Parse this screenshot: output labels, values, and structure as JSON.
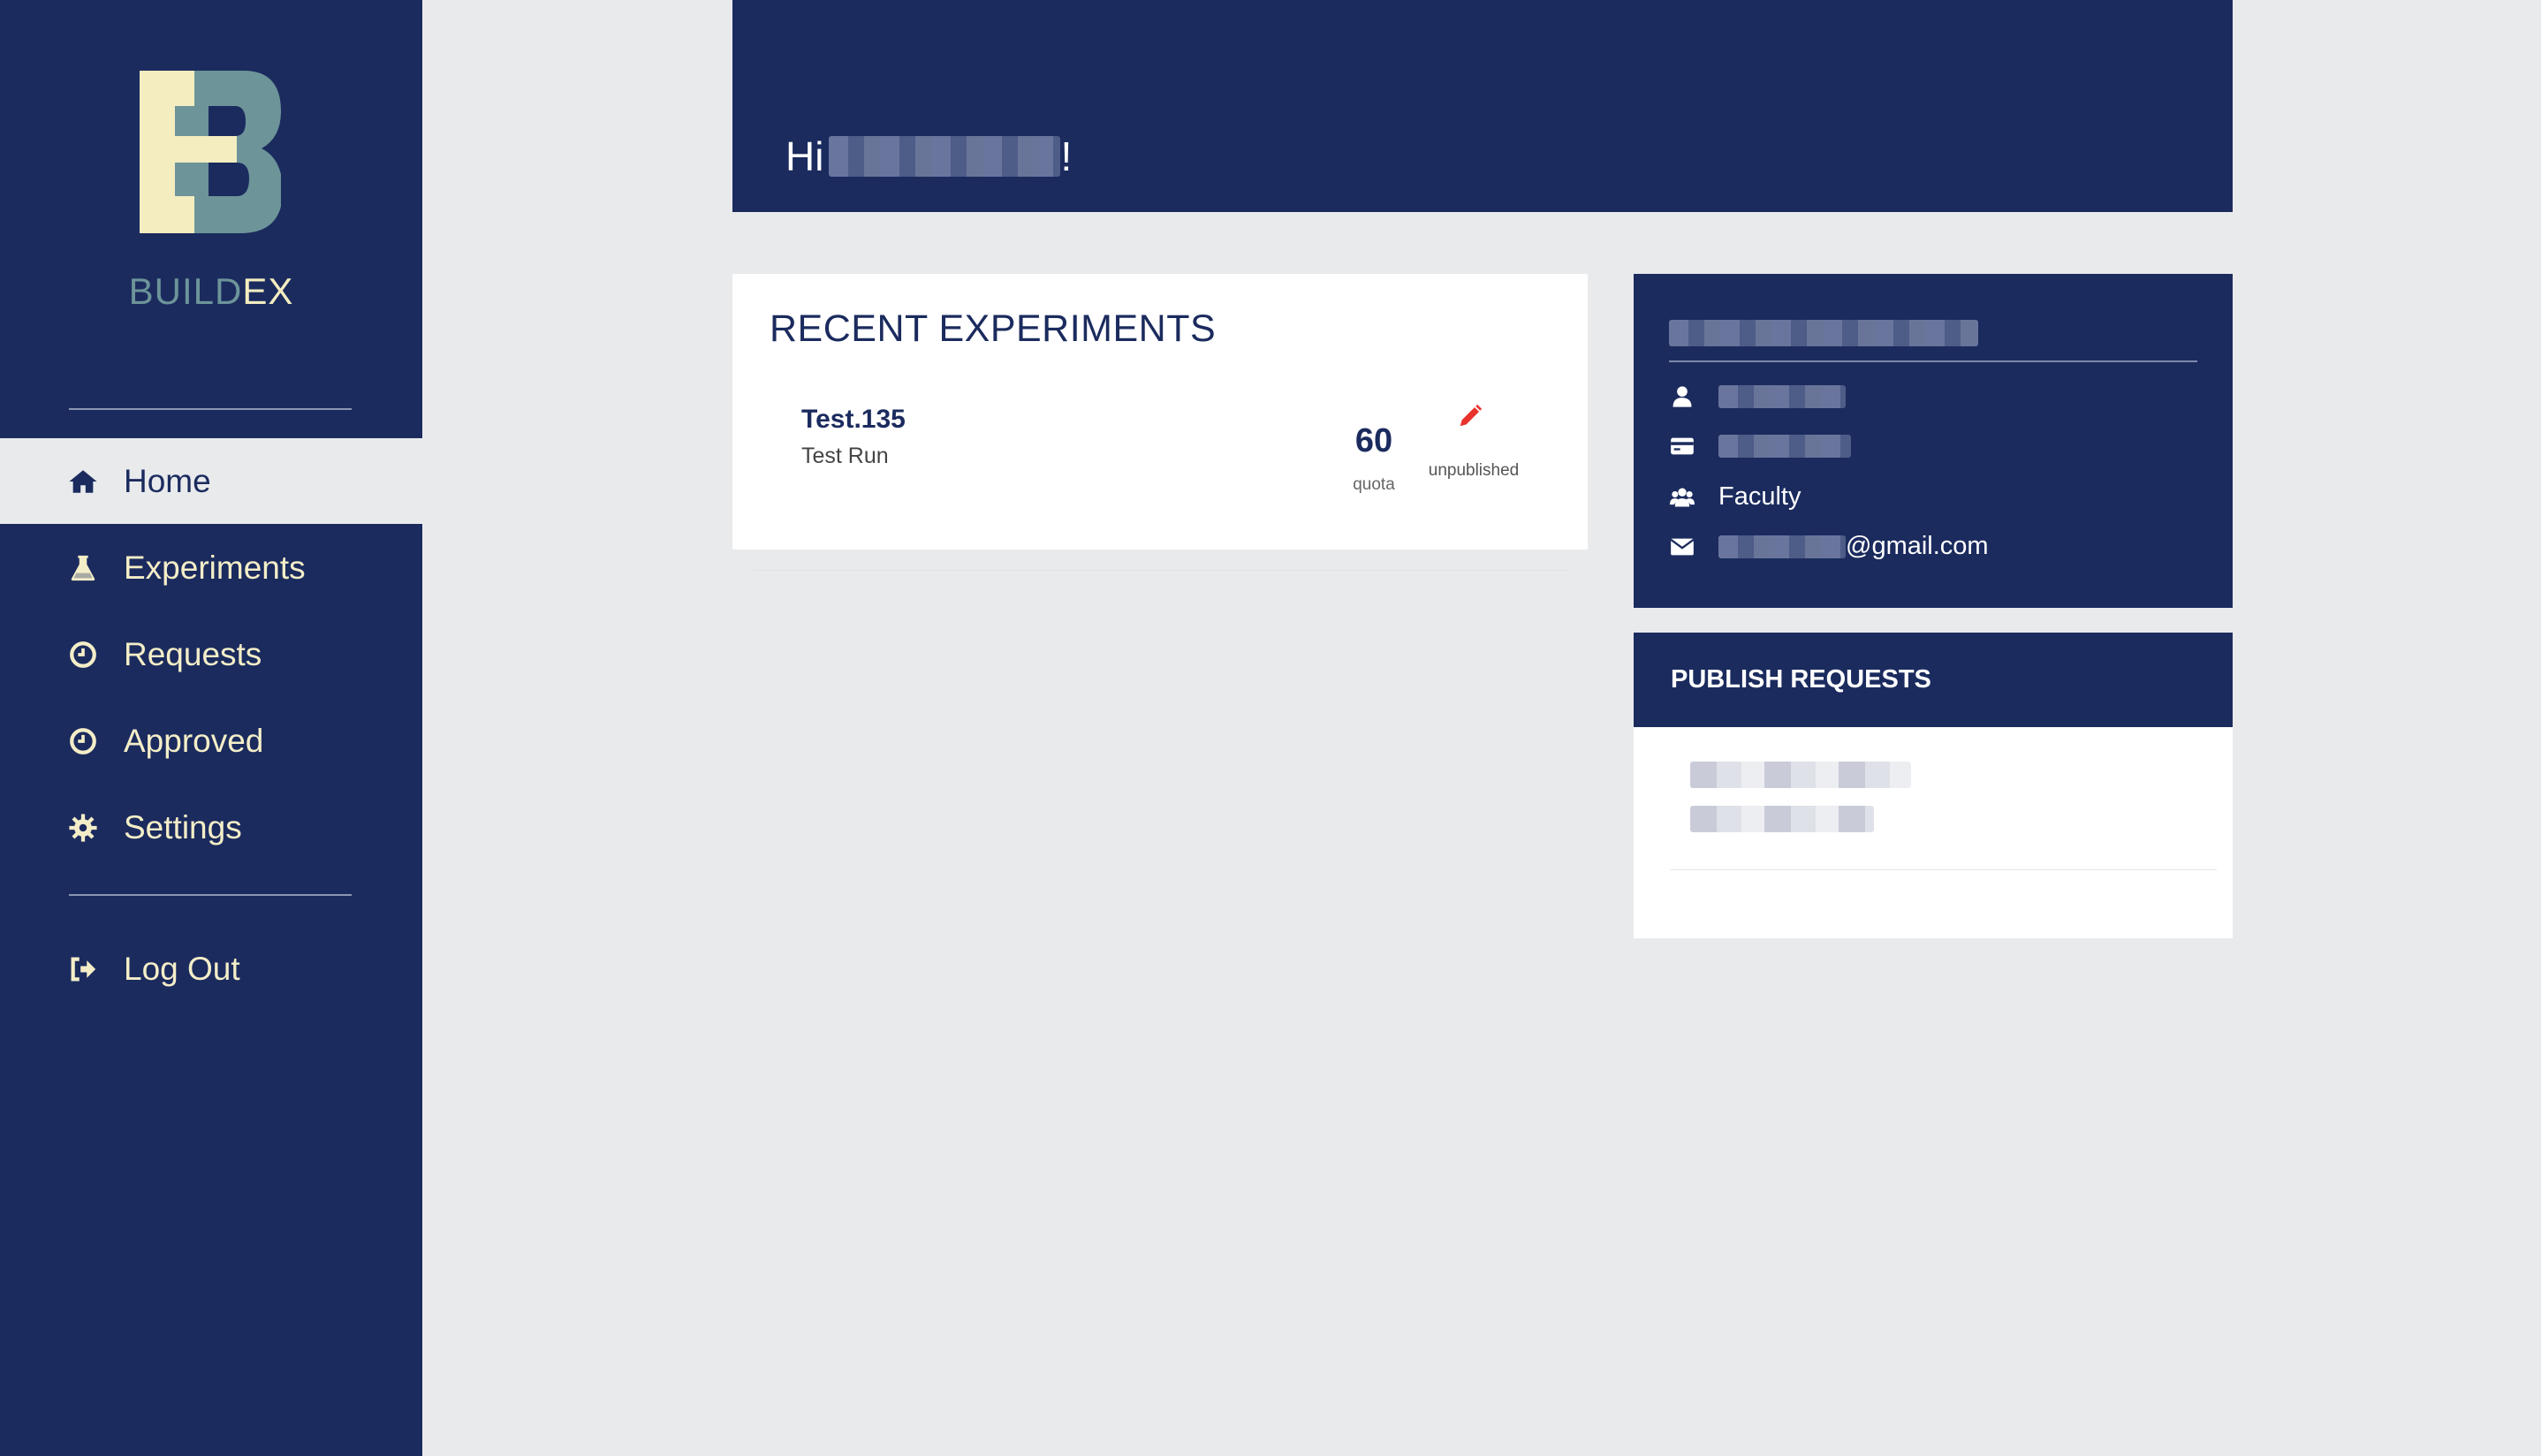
{
  "brand": {
    "part1": "BUILD",
    "part2": "EX"
  },
  "nav": {
    "items": [
      {
        "label": "Home",
        "icon": "home-icon",
        "active": true
      },
      {
        "label": "Experiments",
        "icon": "flask-icon",
        "active": false
      },
      {
        "label": "Requests",
        "icon": "clock-icon",
        "active": false
      },
      {
        "label": "Approved",
        "icon": "clock-icon",
        "active": false
      },
      {
        "label": "Settings",
        "icon": "gear-icon",
        "active": false
      }
    ],
    "logout": {
      "label": "Log Out",
      "icon": "sign-out-icon"
    }
  },
  "header": {
    "greeting_prefix": "Hi",
    "greeting_suffix": "!"
  },
  "recent": {
    "title": "RECENT EXPERIMENTS",
    "experiments": [
      {
        "name": "Test.135",
        "subtitle": "Test Run",
        "quota": "60",
        "quota_label": "quota",
        "status": "unpublished"
      }
    ]
  },
  "profile": {
    "role": "Faculty",
    "email_suffix": "@gmail.com"
  },
  "publish": {
    "title": "PUBLISH REQUESTS"
  },
  "colors": {
    "navy": "#1b2b5e",
    "cream": "#f4eec8",
    "teal": "#6d9499",
    "background": "#e9eaec",
    "edit_red": "#e8322b"
  }
}
